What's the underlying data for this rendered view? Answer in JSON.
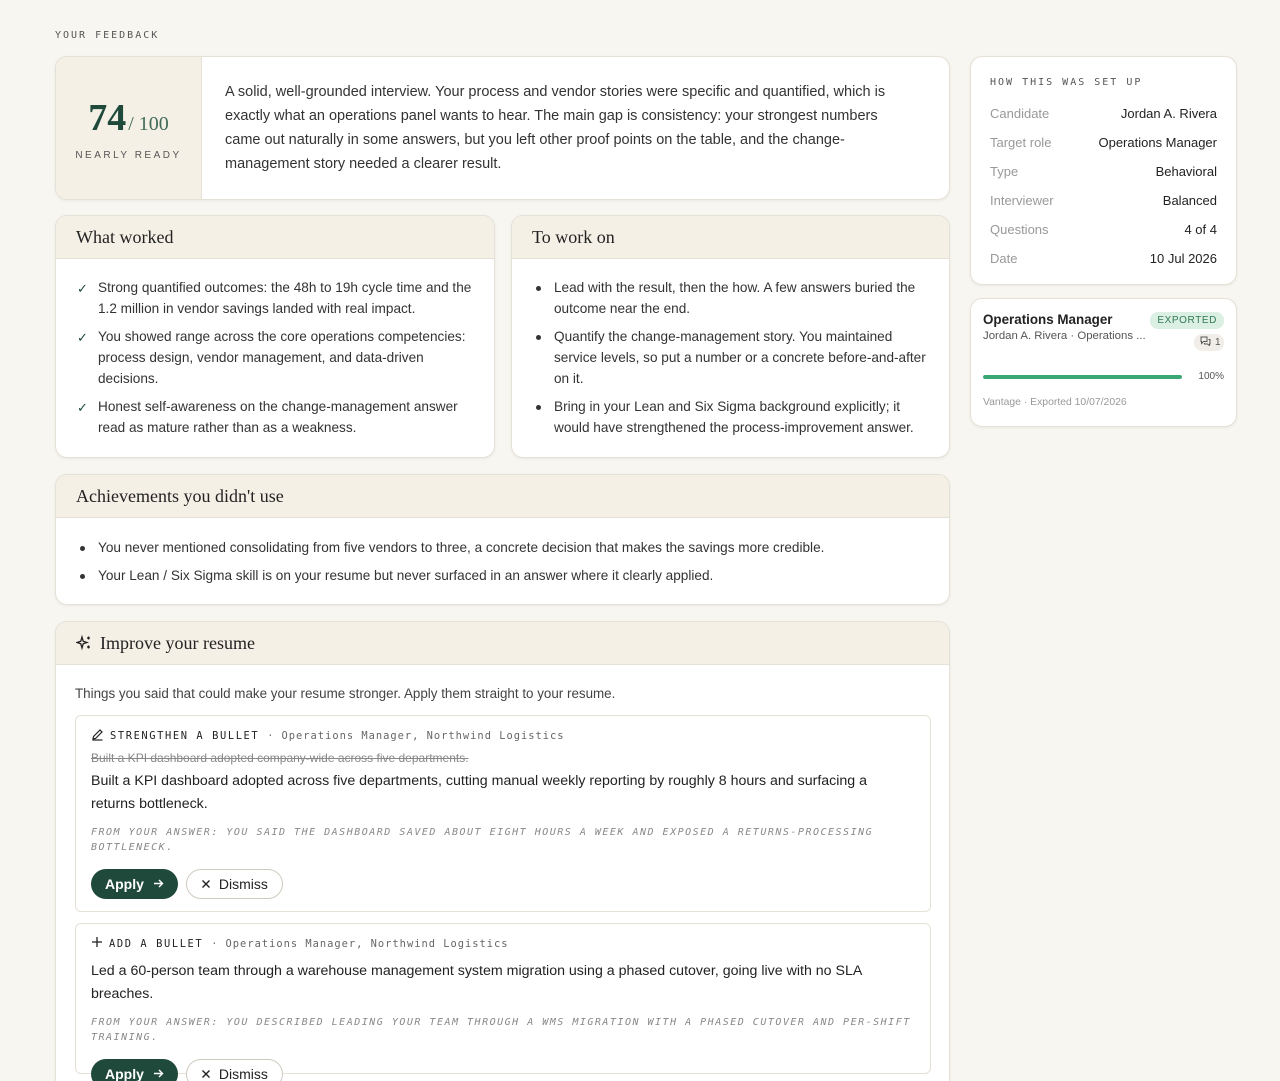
{
  "header": {
    "overline": "YOUR FEEDBACK"
  },
  "score": {
    "value": "74",
    "denominator": "/ 100",
    "status": "NEARLY READY",
    "summary": "A solid, well-grounded interview. Your process and vendor stories were specific and quantified, which is exactly what an operations panel wants to hear. The main gap is consistency: your strongest numbers came out naturally in some answers, but you left other proof points on the table, and the change-management story needed a clearer result."
  },
  "worked": {
    "title": "What worked",
    "items": [
      "Strong quantified outcomes: the 48h to 19h cycle time and the 1.2 million in vendor savings landed with real impact.",
      "You showed range across the core operations competencies: process design, vendor management, and data-driven decisions.",
      "Honest self-awareness on the change-management answer read as mature rather than as a weakness."
    ]
  },
  "work_on": {
    "title": "To work on",
    "items": [
      "Lead with the result, then the how. A few answers buried the outcome near the end.",
      "Quantify the change-management story. You maintained service levels, so put a number or a concrete before-and-after on it.",
      "Bring in your Lean and Six Sigma background explicitly; it would have strengthened the process-improvement answer."
    ]
  },
  "unused": {
    "title": "Achievements you didn't use",
    "items": [
      "You never mentioned consolidating from five vendors to three, a concrete decision that makes the savings more credible.",
      "Your Lean / Six Sigma skill is on your resume but never surfaced in an answer where it clearly applied."
    ]
  },
  "resume": {
    "title": "Improve your resume",
    "intro": "Things you said that could make your resume stronger. Apply them straight to your resume.",
    "suggestions": [
      {
        "kind": "STRENGTHEN A BULLET",
        "context": "Operations Manager, Northwind Logistics",
        "old_text": "Built a KPI dashboard adopted company-wide across five departments.",
        "new_text": "Built a KPI dashboard adopted across five departments, cutting manual weekly reporting by roughly 8 hours and surfacing a returns bottleneck.",
        "source": "FROM YOUR ANSWER: YOU SAID THE DASHBOARD SAVED ABOUT EIGHT HOURS A WEEK AND EXPOSED A RETURNS-PROCESSING BOTTLENECK.",
        "apply_label": "Apply",
        "dismiss_label": "Dismiss"
      },
      {
        "kind": "ADD A BULLET",
        "context": "Operations Manager, Northwind Logistics",
        "new_text": "Led a 60-person team through a warehouse management system migration using a phased cutover, going live with no SLA breaches.",
        "source": "FROM YOUR ANSWER: YOU DESCRIBED LEADING YOUR TEAM THROUGH A WMS MIGRATION WITH A PHASED CUTOVER AND PER-SHIFT TRAINING.",
        "apply_label": "Apply",
        "dismiss_label": "Dismiss"
      }
    ]
  },
  "setup": {
    "title": "HOW THIS WAS SET UP",
    "rows": [
      {
        "label": "Candidate",
        "value": "Jordan A. Rivera"
      },
      {
        "label": "Target role",
        "value": "Operations Manager"
      },
      {
        "label": "Type",
        "value": "Behavioral"
      },
      {
        "label": "Interviewer",
        "value": "Balanced"
      },
      {
        "label": "Questions",
        "value": "4 of 4"
      },
      {
        "label": "Date",
        "value": "10 Jul 2026"
      }
    ]
  },
  "export": {
    "title": "Operations Manager",
    "subtitle": "Jordan A. Rivera · Operations ...",
    "badge": "EXPORTED",
    "comment_count": "1",
    "progress": 100,
    "progress_label": "100%",
    "footer": "Vantage · Exported 10/07/2026",
    "accent_color": "#3aa873"
  },
  "colors": {
    "brand": "#1f4a3b",
    "panel": "#f5f0e6",
    "background": "#f8f6f1"
  }
}
